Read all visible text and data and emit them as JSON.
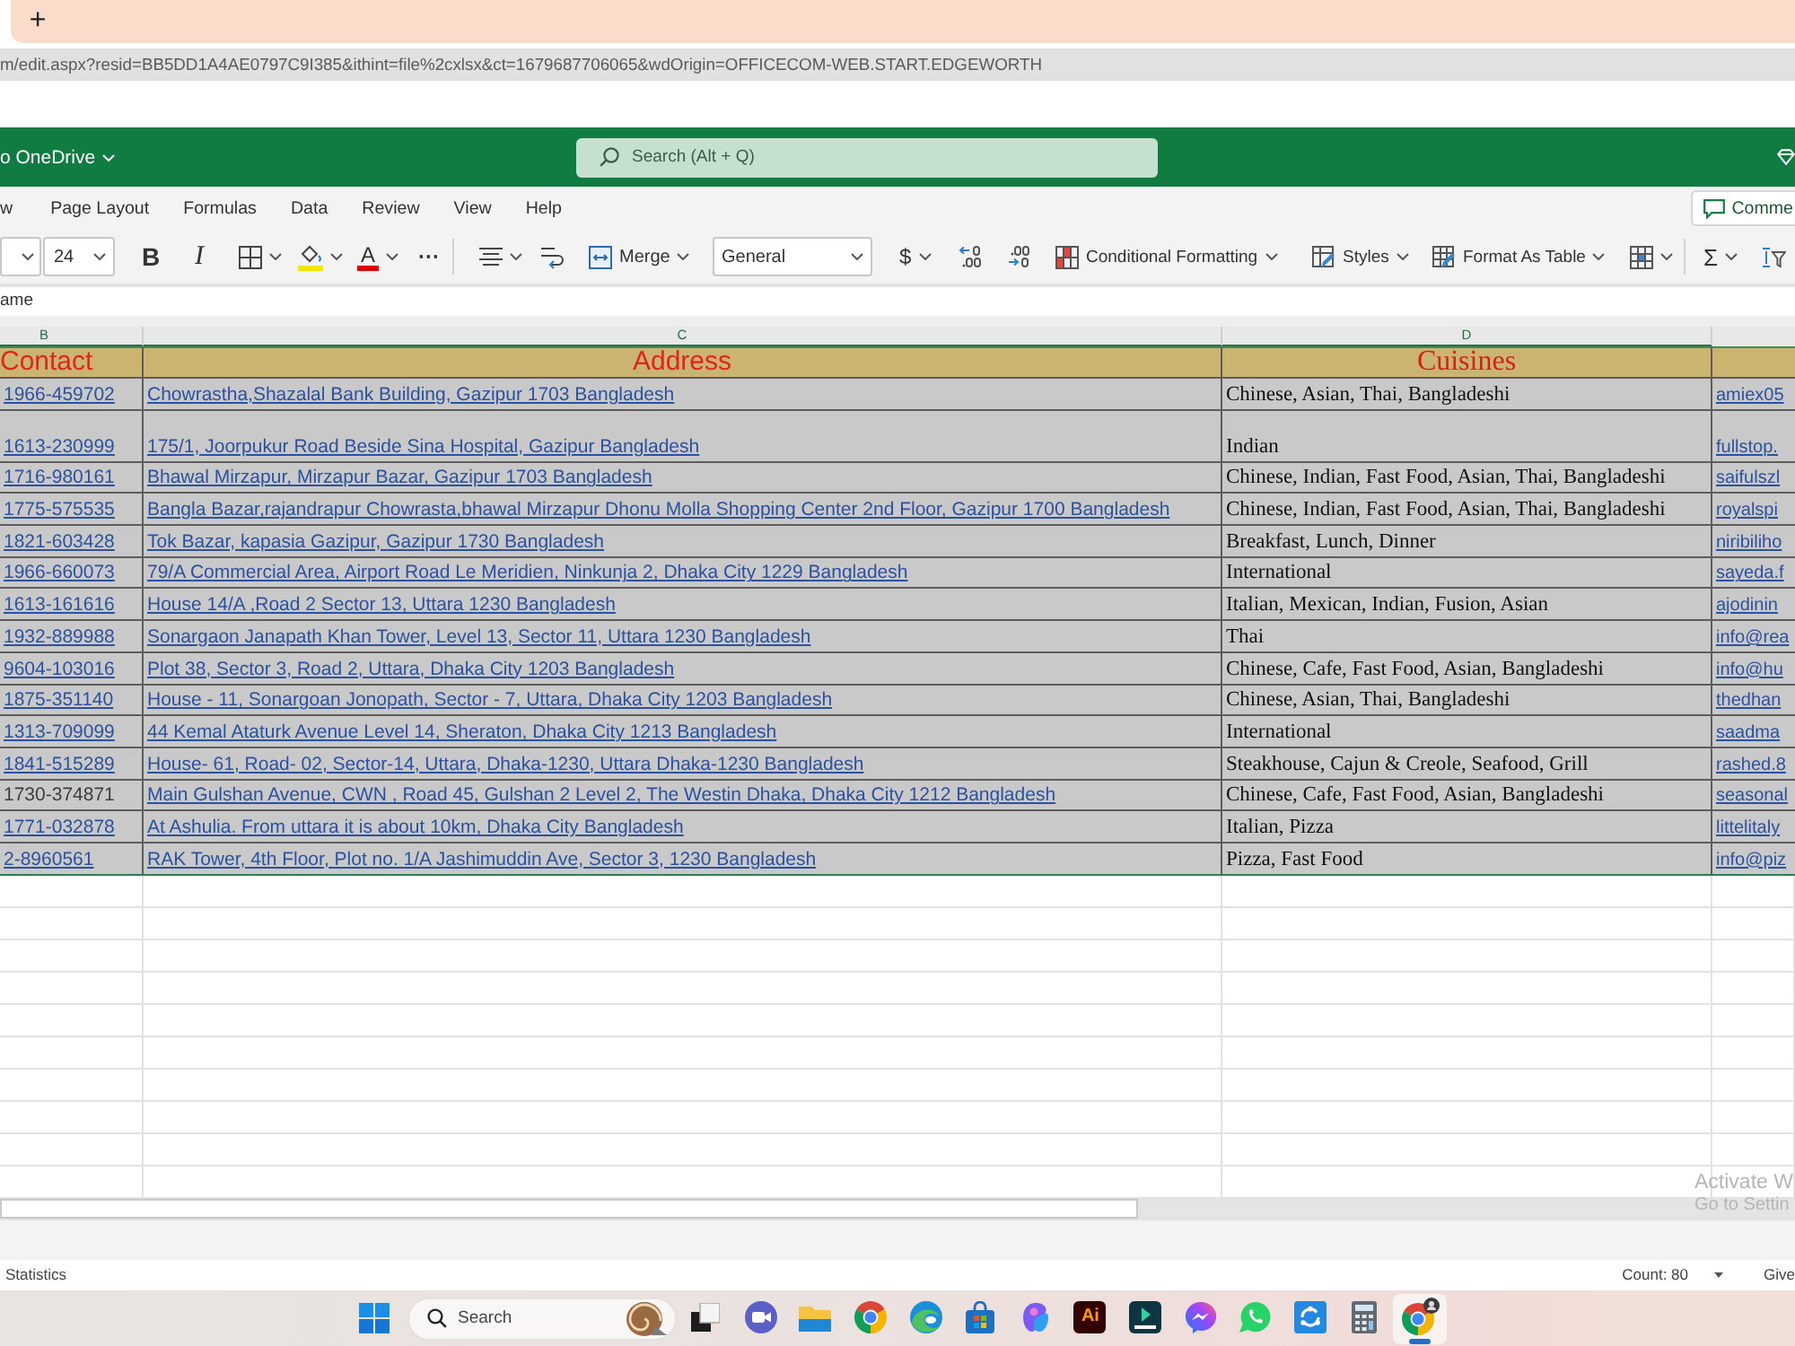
{
  "browser": {
    "new_tab": "+",
    "url": "m/edit.aspx?resid=BB5DD1A4AE0797C9I385&ithint=file%2cxlsx&ct=1679687706065&wdOrigin=OFFICECOM-WEB.START.EDGEWORTH"
  },
  "app_header": {
    "save_status": "o OneDrive",
    "search_placeholder": "Search (Alt + Q)"
  },
  "ribbon_tabs": [
    {
      "label": "w",
      "selected": false
    },
    {
      "label": "Page Layout",
      "selected": false
    },
    {
      "label": "Formulas",
      "selected": false
    },
    {
      "label": "Data",
      "selected": false
    },
    {
      "label": "Review",
      "selected": false
    },
    {
      "label": "View",
      "selected": false
    },
    {
      "label": "Help",
      "selected": false
    }
  ],
  "comments_button": "Comme",
  "toolbar": [
    {
      "kind": "font-name"
    },
    {
      "kind": "font-size",
      "value": "24"
    },
    {
      "kind": "bold",
      "glyph": "B"
    },
    {
      "kind": "italic",
      "glyph": "I"
    },
    {
      "kind": "borders"
    },
    {
      "kind": "fill-color"
    },
    {
      "kind": "font-color",
      "glyph": "A"
    },
    {
      "kind": "more",
      "glyph": "···"
    },
    {
      "kind": "divider"
    },
    {
      "kind": "align"
    },
    {
      "kind": "wrap-text"
    },
    {
      "kind": "merge",
      "label": "Merge"
    },
    {
      "kind": "number-format",
      "value": "General"
    },
    {
      "kind": "currency",
      "glyph": "$"
    },
    {
      "kind": "increase-decimal"
    },
    {
      "kind": "decrease-decimal"
    },
    {
      "kind": "conditional-formatting",
      "label": "Conditional Formatting"
    },
    {
      "kind": "styles",
      "label": "Styles"
    },
    {
      "kind": "format-as-table",
      "label": "Format As Table"
    },
    {
      "kind": "insert-cells"
    },
    {
      "kind": "divider"
    },
    {
      "kind": "autosum",
      "glyph": "Σ"
    },
    {
      "kind": "sort"
    }
  ],
  "formula_bar": {
    "value": "ame"
  },
  "sheet": {
    "columns": [
      {
        "letter": "B",
        "heading": "Contact",
        "selected": true
      },
      {
        "letter": "C",
        "heading": "Address",
        "selected": true
      },
      {
        "letter": "D",
        "heading": "Cuisines",
        "selected": true
      }
    ],
    "rows": [
      {
        "contact": {
          "text": "1966-459702",
          "link": true
        },
        "address": "Chowrastha,Shazalal Bank Building, Gazipur 1703 Bangladesh",
        "cuisines": "Chinese, Asian, Thai, Bangladeshi",
        "column_4": "amiex05"
      },
      {
        "contact": {
          "text": "1613-230999",
          "link": true
        },
        "address": "175/1, Joorpukur Road Beside Sina Hospital, Gazipur Bangladesh",
        "cuisines": "Indian",
        "column_4": "fullstop."
      },
      {
        "contact": {
          "text": "1716-980161",
          "link": true
        },
        "address": "Bhawal Mirzapur, Mirzapur Bazar, Gazipur 1703 Bangladesh",
        "cuisines": "Chinese, Indian, Fast Food, Asian, Thai, Bangladeshi",
        "column_4": "saifulszl"
      },
      {
        "contact": {
          "text": "1775-575535",
          "link": true
        },
        "address": "Bangla Bazar,rajandrapur Chowrasta,bhawal Mirzapur Dhonu Molla Shopping Center 2nd Floor, Gazipur 1700 Bangladesh",
        "cuisines": "Chinese, Indian, Fast Food, Asian, Thai, Bangladeshi",
        "column_4": "royalspi"
      },
      {
        "contact": {
          "text": "1821-603428",
          "link": true
        },
        "address": "Tok Bazar, kapasia Gazipur, Gazipur 1730 Bangladesh",
        "cuisines": "Breakfast, Lunch, Dinner",
        "column_4": "niribiliho"
      },
      {
        "contact": {
          "text": "1966-660073",
          "link": true
        },
        "address": "79/A Commercial Area, Airport Road Le Meridien, Ninkunja 2, Dhaka City 1229 Bangladesh",
        "cuisines": "International",
        "column_4": "sayeda.f"
      },
      {
        "contact": {
          "text": "1613-161616",
          "link": true
        },
        "address": "House 14/A ,Road 2 Sector 13, Uttara 1230 Bangladesh",
        "cuisines": "Italian, Mexican, Indian, Fusion, Asian",
        "column_4": "ajodinin"
      },
      {
        "contact": {
          "text": "1932-889988",
          "link": true
        },
        "address": "Sonargaon Janapath Khan Tower, Level 13, Sector 11, Uttara 1230 Bangladesh",
        "cuisines": "Thai",
        "column_4": "info@rea"
      },
      {
        "contact": {
          "text": "9604-103016",
          "link": true
        },
        "address": "Plot 38, Sector 3, Road 2, Uttara, Dhaka City 1203 Bangladesh",
        "cuisines": "Chinese, Cafe, Fast Food, Asian, Bangladeshi",
        "column_4": "info@hu"
      },
      {
        "contact": {
          "text": "1875-351140",
          "link": true
        },
        "address": "House - 11, Sonargoan Jonopath, Sector - 7, Uttara, Dhaka City 1203 Bangladesh",
        "cuisines": "Chinese, Asian, Thai, Bangladeshi",
        "column_4": "thedhan"
      },
      {
        "contact": {
          "text": "1313-709099",
          "link": true
        },
        "address": "44 Kemal Ataturk Avenue Level 14, Sheraton, Dhaka City 1213 Bangladesh",
        "cuisines": "International",
        "column_4": "saadma"
      },
      {
        "contact": {
          "text": "1841-515289",
          "link": true
        },
        "address": "House- 61, Road- 02, Sector-14, Uttara, Dhaka-1230, Uttara Dhaka-1230 Bangladesh",
        "cuisines": "Steakhouse, Cajun & Creole, Seafood, Grill",
        "column_4": "rashed.8"
      },
      {
        "contact": {
          "text": "1730-374871",
          "link": false
        },
        "address": "Main Gulshan Avenue, CWN , Road 45, Gulshan 2 Level 2, The Westin Dhaka, Dhaka City 1212 Bangladesh",
        "cuisines": "Chinese, Cafe, Fast Food, Asian, Bangladeshi",
        "column_4": "seasonal"
      },
      {
        "contact": {
          "text": "1771-032878",
          "link": true
        },
        "address": "At Ashulia. From uttara it is about 10km, Dhaka City Bangladesh",
        "cuisines": "Italian, Pizza",
        "column_4": "littelitaly"
      },
      {
        "contact": {
          "text": "2-8960561",
          "link": true
        },
        "address": "RAK Tower, 4th Floor, Plot no. 1/A Jashimuddin Ave, Sector 3, 1230 Bangladesh",
        "cuisines": "Pizza, Fast Food",
        "column_4": "info@piz"
      }
    ]
  },
  "os_notice": {
    "title": "Activate W",
    "hint": "Go to Settin"
  },
  "status_bar": {
    "statistics": "Statistics",
    "count": "Count: 80",
    "feedback": "Give"
  },
  "taskbar": {
    "search_placeholder": "Search",
    "apps": [
      {
        "kind": "task-view",
        "active": false
      },
      {
        "kind": "video-chat",
        "active": false
      },
      {
        "kind": "folder",
        "active": false
      },
      {
        "kind": "browser",
        "active": false
      },
      {
        "kind": "wave-browser",
        "active": false
      },
      {
        "kind": "store",
        "active": false
      },
      {
        "kind": "blob",
        "active": false
      },
      {
        "kind": "letter-tile",
        "label": "Ai",
        "active": false
      },
      {
        "kind": "arrow-tile",
        "active": false
      },
      {
        "kind": "messenger",
        "active": false
      },
      {
        "kind": "phone-chat",
        "active": false
      },
      {
        "kind": "sync-tile",
        "active": false
      },
      {
        "kind": "calculator",
        "active": false
      },
      {
        "kind": "browser-badge",
        "active": true
      }
    ]
  }
}
